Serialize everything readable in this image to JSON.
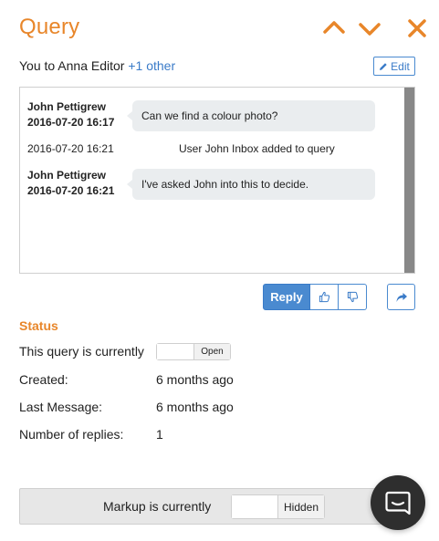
{
  "header": {
    "title": "Query",
    "icons": [
      "chevron-up-icon",
      "chevron-down-icon",
      "close-icon"
    ],
    "accent_color": "#e8862a"
  },
  "recipients": {
    "prefix": "You to Anna Editor ",
    "more_label": "+1 other",
    "edit_label": "Edit"
  },
  "thread": {
    "messages": [
      {
        "author": "John Pettigrew",
        "timestamp": "2016-07-20 16:17",
        "text": "Can we find a colour photo?"
      },
      {
        "author": "John Pettigrew",
        "timestamp": "2016-07-20 16:21",
        "text": "I've asked John into this to decide."
      }
    ],
    "system_event": {
      "timestamp": "2016-07-20 16:21",
      "text": "User John Inbox added to query"
    }
  },
  "actions": {
    "reply_label": "Reply",
    "icons": [
      "thumbs-up-icon",
      "thumbs-down-icon",
      "forward-icon"
    ],
    "primary_color": "#4a8ad0"
  },
  "status": {
    "heading": "Status",
    "current_label": "This query is currently",
    "current_value": "Open",
    "created_label": "Created:",
    "created_value": "6 months ago",
    "last_message_label": "Last Message:",
    "last_message_value": "6 months ago",
    "replies_label": "Number of replies:",
    "replies_value": "1"
  },
  "markup": {
    "label": "Markup is currently",
    "value": "Hidden"
  },
  "chat_launcher": {
    "icon": "chat-icon"
  }
}
